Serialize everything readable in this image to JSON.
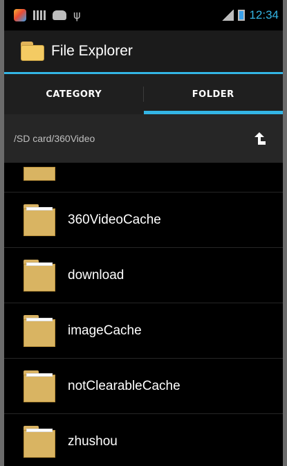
{
  "status_bar": {
    "icons": [
      "app-icon",
      "grid-icon",
      "cat-icon",
      "usb-icon",
      "signal-icon",
      "battery-icon"
    ],
    "time": "12:34"
  },
  "action_bar": {
    "title": "File Explorer",
    "icon": "folder-icon"
  },
  "tabs": [
    {
      "label": "CATEGORY",
      "active": false
    },
    {
      "label": "FOLDER",
      "active": true
    }
  ],
  "path_bar": {
    "path": "/SD card/360Video",
    "up_icon": "up-arrow-icon"
  },
  "folders": [
    {
      "name": "360VideoCache"
    },
    {
      "name": "download"
    },
    {
      "name": "imageCache"
    },
    {
      "name": "notClearableCache"
    },
    {
      "name": "zhushou"
    }
  ],
  "colors": {
    "accent": "#33b5e5",
    "folder": "#d9b462",
    "background": "#000000"
  }
}
